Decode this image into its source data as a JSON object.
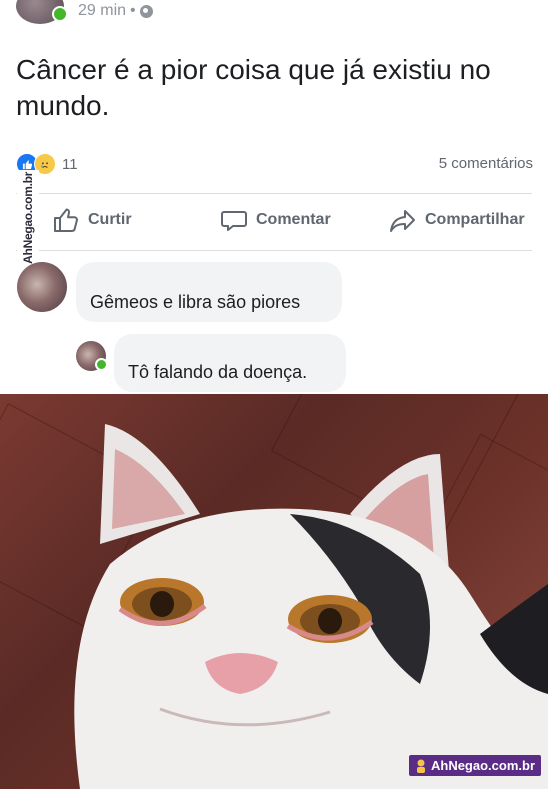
{
  "post": {
    "time": "29 min",
    "separator": "•",
    "text": "Câncer é a pior coisa que já existiu no mundo.",
    "reactions_count": "11",
    "comments_count": "5 comentários"
  },
  "actions": {
    "like": "Curtir",
    "comment": "Comentar",
    "share": "Compartilhar"
  },
  "comments": [
    {
      "text": "Gêmeos e libra são piores"
    },
    {
      "text": "Tô falando da doença."
    }
  ],
  "watermark": {
    "side": "AhNegao.com.br",
    "badge": "AhNegao.com.br"
  },
  "colors": {
    "like_blue": "#1877f2",
    "online_green": "#42b72a",
    "meta_gray": "#90949c",
    "badge_purple": "#5b2c86"
  },
  "image": {
    "subject": "crying-smiling-cat-meme"
  }
}
